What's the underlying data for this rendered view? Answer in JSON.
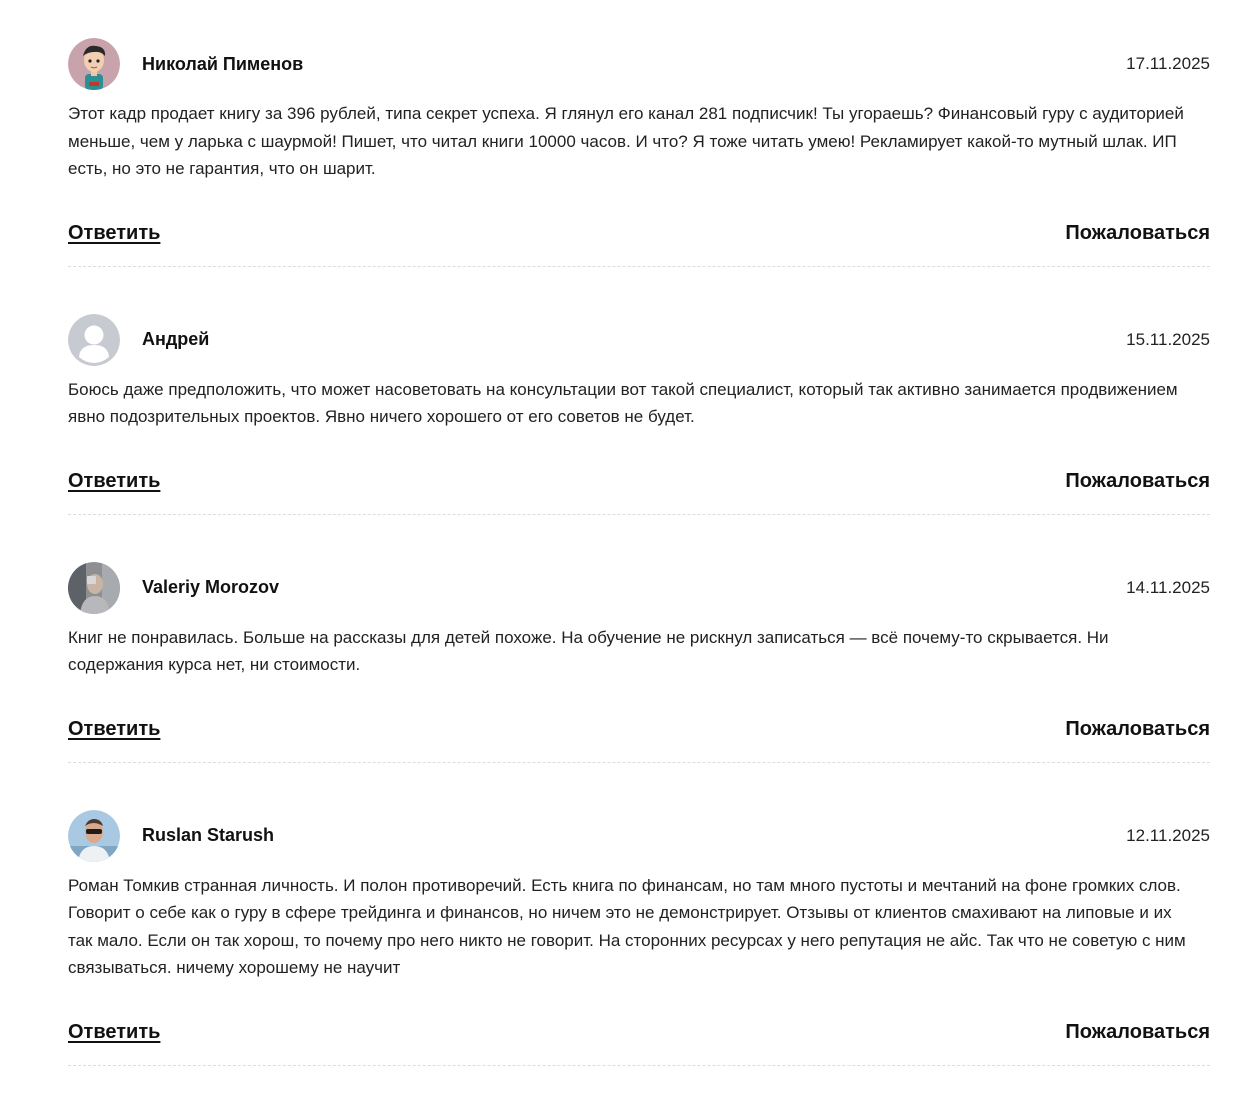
{
  "comments": [
    {
      "author": "Николай Пименов",
      "date": "17.11.2025",
      "avatar_icon": "cartoon-man-avatar",
      "text": "Этот кадр продает книгу за 396 рублей, типа секрет успеха. Я глянул его канал 281 подписчик! Ты угораешь? Финансовый гуру с аудиторией меньше, чем у ларька с шаурмой! Пишет, что читал книги 10000 часов. И что? Я тоже читать умею! Рекламирует какой-то мутный шлак. ИП есть, но это не гарантия, что он шарит.",
      "reply_label": "Ответить",
      "report_label": "Пожаловаться"
    },
    {
      "author": "Андрей",
      "date": "15.11.2025",
      "avatar_icon": "default-user-avatar",
      "text": "Боюсь даже предположить, что может насоветовать на консультации вот такой специалист, который так активно занимается продвижением явно подозрительных проектов. Явно ничего хорошего от его советов не будет.",
      "reply_label": "Ответить",
      "report_label": "Пожаловаться"
    },
    {
      "author": "Valeriy Morozov",
      "date": "14.11.2025",
      "avatar_icon": "photo-avatar",
      "text": "Книг не понравилась. Больше на рассказы для детей похоже. На обучение не рискнул записаться — всё почему-то скрывается. Ни содержания курса нет, ни стоимости.",
      "reply_label": "Ответить",
      "report_label": "Пожаловаться"
    },
    {
      "author": "Ruslan Starush",
      "date": "12.11.2025",
      "avatar_icon": "photo-avatar",
      "text": "Роман Томкив странная личность. И полон противоречий. Есть книга по финансам, но там много пустоты и мечтаний на фоне громких слов. Говорит о себе как о гуру в сфере трейдинга и финансов, но ничем это не демонстрирует. Отзывы от клиентов смахивают на липовые и их так мало. Если он так хорош, то почему про него никто не говорит. На сторонних ресурсах у него репутация не айс. Так что не советую с ним связываться. ничему хорошему не научит",
      "reply_label": "Ответить",
      "report_label": "Пожаловаться"
    }
  ]
}
